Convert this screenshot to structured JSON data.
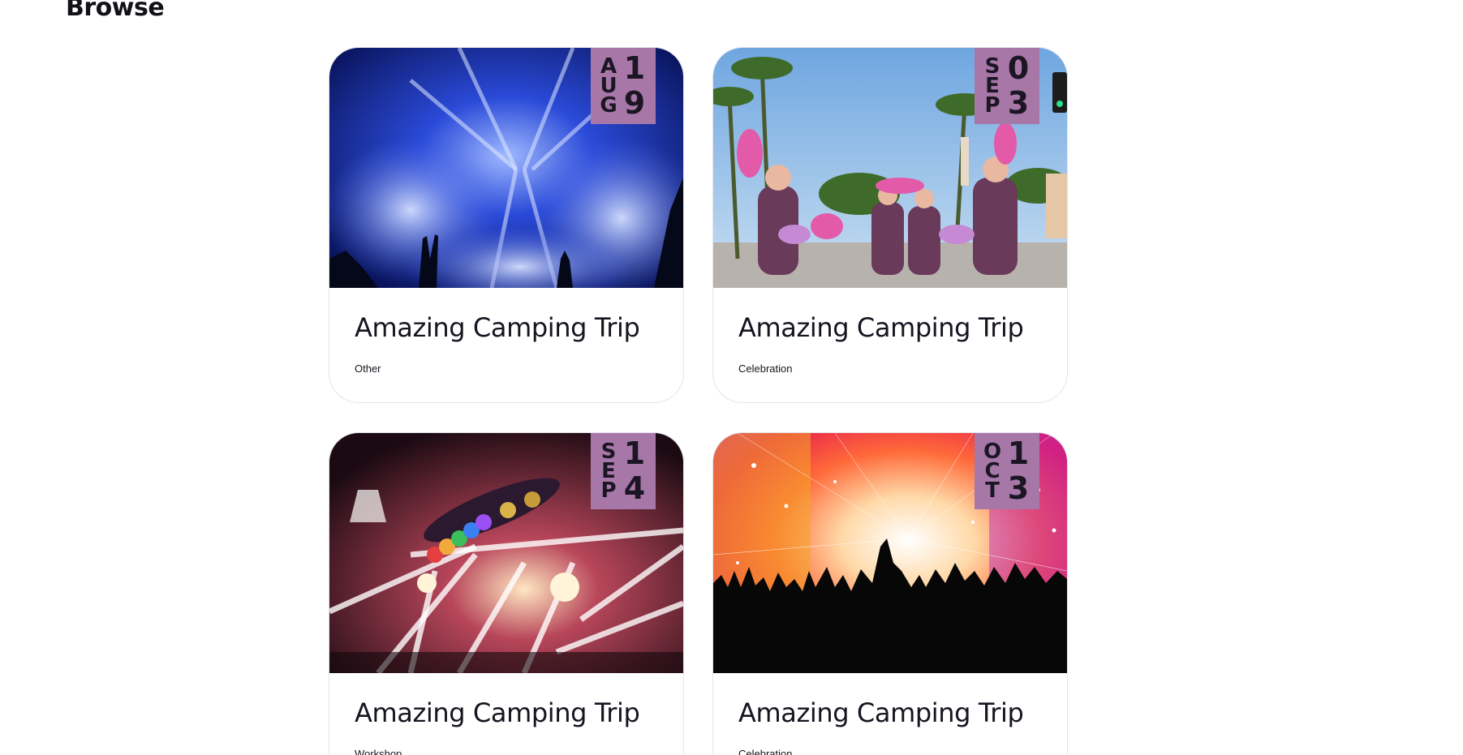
{
  "page": {
    "title": "Browse"
  },
  "events": [
    {
      "month": "AUG",
      "day": "19",
      "title": "Amazing Camping Trip",
      "category": "Other",
      "image": "concert-blue-stage-lights-image"
    },
    {
      "month": "SEP",
      "day": "03",
      "title": "Amazing Camping Trip",
      "category": "Celebration",
      "image": "street-parade-dancers-image"
    },
    {
      "month": "SEP",
      "day": "14",
      "title": "Amazing Camping Trip",
      "category": "Workshop",
      "image": "stage-light-beams-balloons-image"
    },
    {
      "month": "OCT",
      "day": "13",
      "title": "Amazing Camping Trip",
      "category": "Celebration",
      "image": "crowd-silhouette-starburst-image"
    }
  ],
  "colors": {
    "badge": "#a777a8",
    "text": "#15151f",
    "background": "#ffffff"
  }
}
